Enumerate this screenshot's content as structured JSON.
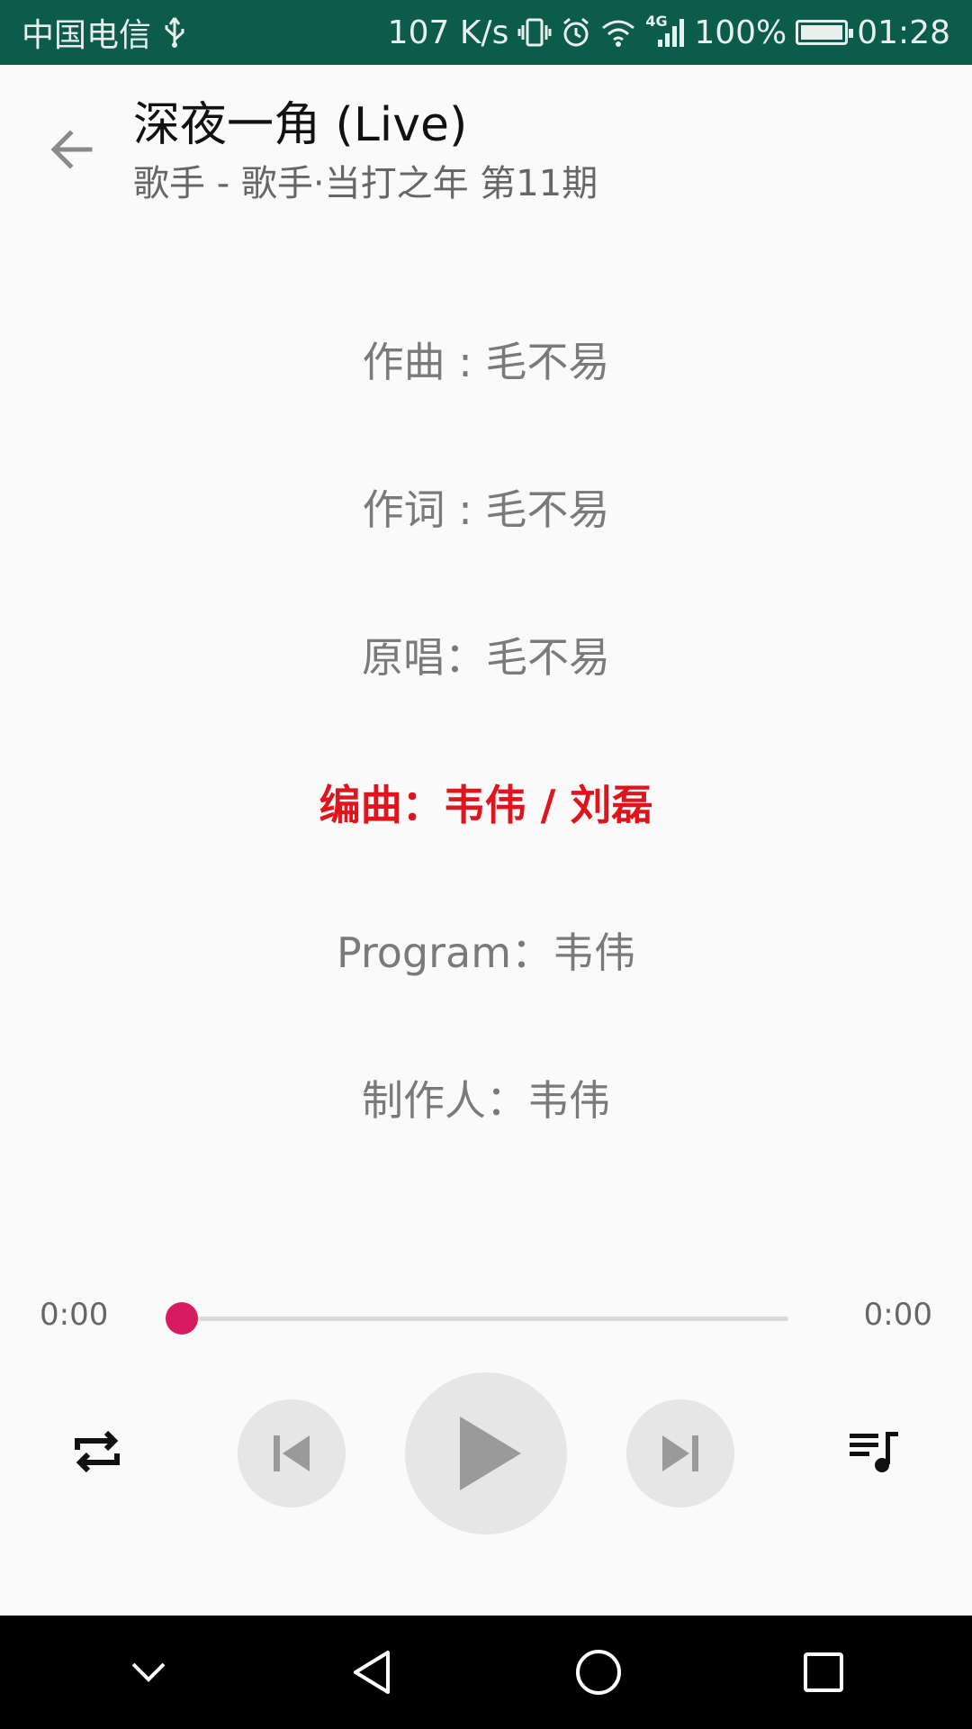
{
  "status_bar": {
    "carrier": "中国电信",
    "speed": "107 K/s",
    "network_badge": "4G",
    "battery_percent": "100%",
    "battery_level": 1.0,
    "time": "01:28",
    "icons": [
      "usb-icon",
      "vibrate-icon",
      "alarm-icon",
      "wifi-icon",
      "signal-icon",
      "battery-icon"
    ]
  },
  "header": {
    "title": "深夜一角 (Live)",
    "subtitle": "歌手 - 歌手·当打之年 第11期",
    "back_icon": "arrow-left-icon"
  },
  "lyrics": [
    {
      "text": "作曲 : 毛不易",
      "active": false
    },
    {
      "text": "作词 : 毛不易",
      "active": false
    },
    {
      "text": "原唱：毛不易",
      "active": false
    },
    {
      "text": "编曲：韦伟 / 刘磊",
      "active": true
    },
    {
      "text": "Program：韦伟",
      "active": false
    },
    {
      "text": "制作人：韦伟",
      "active": false
    }
  ],
  "player": {
    "current_time": "0:00",
    "total_time": "0:00",
    "progress": 0.0,
    "accent_color": "#d81b60",
    "active_lyric_color": "#e0141c",
    "controls": [
      "repeat-icon",
      "skip-previous-icon",
      "play-icon",
      "skip-next-icon",
      "queue-music-icon"
    ]
  },
  "nav_bar": {
    "buttons": [
      "chevron-down-icon",
      "back-triangle-icon",
      "home-circle-icon",
      "recents-square-icon"
    ]
  }
}
